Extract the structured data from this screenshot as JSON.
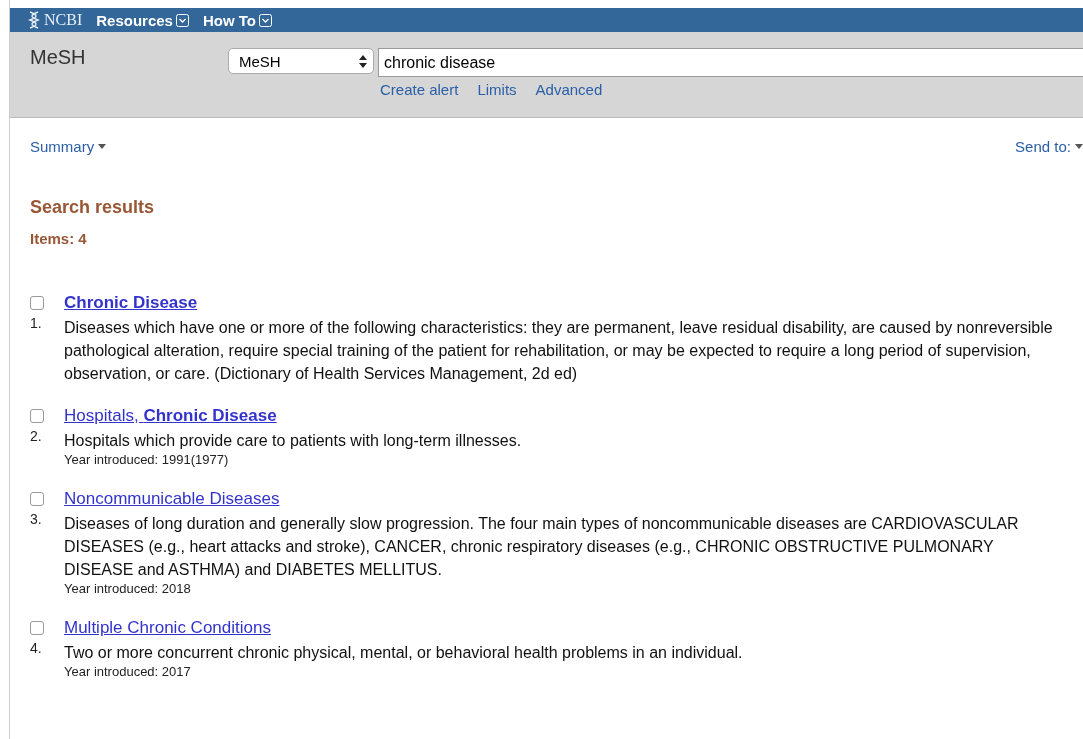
{
  "topbar": {
    "logo": "NCBI",
    "menus": [
      {
        "label": "Resources"
      },
      {
        "label": "How To"
      }
    ]
  },
  "search": {
    "database_title": "MeSH",
    "database": "MeSH",
    "query": "chronic disease",
    "links": [
      "Create alert",
      "Limits",
      "Advanced"
    ]
  },
  "toolbar": {
    "format": "Summary",
    "send_to": "Send to:"
  },
  "results": {
    "heading": "Search results",
    "count": "Items: 4",
    "items": [
      {
        "number": "1.",
        "title": "**Chronic Disease**",
        "selected": false,
        "description": "Diseases which have one or more of the following characteristics: they are permanent, leave residual disability, are caused by nonreversible pathological alteration, require special training of the patient for rehabilitation, or may be expected to require a long period of supervision, observation, or care. (Dictionary of Health Services Management, 2d ed)"
      },
      {
        "number": "2.",
        "title": "Hospitals, **Chronic Disease**",
        "selected": false,
        "description": "Hospitals which provide care to patients with long-term illnesses.",
        "year": "Year introduced: 1991(1977)"
      },
      {
        "number": "3.",
        "title": "Noncommunicable Diseases",
        "selected": false,
        "description": "Diseases of long duration and generally slow progression. The four main types of noncommunicable diseases are CARDIOVASCULAR DISEASES (e.g., heart attacks and stroke), CANCER, chronic respiratory diseases (e.g., CHRONIC OBSTRUCTIVE PULMONARY DISEASE and ASTHMA) and DIABETES MELLITUS.",
        "year": "Year introduced: 2018"
      },
      {
        "number": "4.",
        "title": "Multiple Chronic Conditions",
        "selected": false,
        "description": "Two or more concurrent chronic physical, mental, or behavioral health problems in an individual.",
        "year": "Year introduced: 2017"
      }
    ]
  }
}
